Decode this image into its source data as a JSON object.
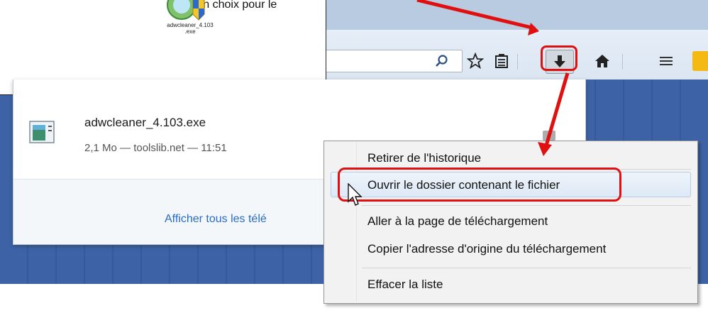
{
  "callout": {
    "text": "e son choix pour le",
    "file_name": "adwcleaner_4.103 .exe"
  },
  "downloads_panel": {
    "item": {
      "filename": "adwcleaner_4.103.exe",
      "details": "2,1 Mo — toolslib.net — 11:51"
    },
    "show_all_label": "Afficher tous les télé"
  },
  "context_menu": {
    "items": [
      {
        "label": "Retirer de l'historique"
      },
      {
        "label": "Ouvrir le dossier contenant le fichier"
      },
      {
        "label": "Aller à la page de téléchargement"
      },
      {
        "label": "Copier l'adresse d'origine du téléchargement"
      },
      {
        "label": "Effacer la liste"
      }
    ]
  },
  "annotation_color": "#e01010",
  "link_color": "#2a6cc6"
}
